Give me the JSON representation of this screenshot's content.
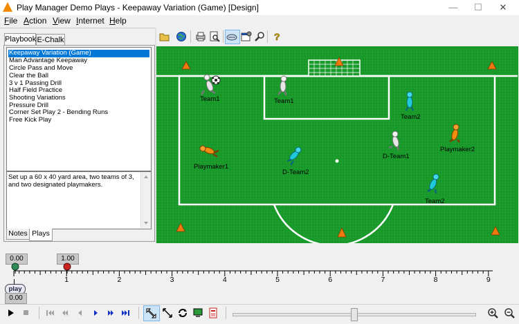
{
  "window": {
    "title": "Play Manager Demo Plays - Keepaway Variation (Game) [Design]",
    "controls": {
      "minimize": "—",
      "maximize": "☐",
      "close": "✕"
    }
  },
  "menu": {
    "items": [
      {
        "label": "File",
        "accel": "F",
        "rest": "ile"
      },
      {
        "label": "Action",
        "accel": "A",
        "rest": "ction"
      },
      {
        "label": "View",
        "accel": "V",
        "rest": "iew"
      },
      {
        "label": "Internet",
        "accel": "I",
        "rest": "nternet"
      },
      {
        "label": "Help",
        "accel": "H",
        "rest": "elp"
      }
    ]
  },
  "left_panel": {
    "tabs": [
      "Playbook",
      "E-Chalk"
    ],
    "plays": [
      "Keepaway Variation (Game)",
      "Man Advantage Keepaway",
      "Circle Pass and Move",
      "Clear the Ball",
      "3 v 1 Passing Drill",
      "Half Field Practice",
      "Shooting Variations",
      "Pressure Drill",
      "Corner Set Play 2 - Bending Runs",
      "Free Kick Play"
    ],
    "selected_play": "Keepaway Variation (Game)",
    "notes_text": "Set up a 60 x 40 yard area, two teams of 3, and two designated playmakers.",
    "bottom_tabs": [
      "Notes",
      "Plays"
    ]
  },
  "toolbar": {
    "icons": [
      "open-folder-icon",
      "globe-icon",
      "print-icon",
      "print-preview-icon",
      "field-view-icon",
      "properties-icon",
      "zoom-tool-icon",
      "help-icon"
    ]
  },
  "field": {
    "colors": {
      "grass": "#1b9a2c",
      "lines": "#ffffff",
      "cone": "#f07a10",
      "team1": "#e6e6e6",
      "team2": "#20c8dc",
      "playmaker": "#f08c10"
    },
    "players": [
      {
        "label": "Team1",
        "team": "team1"
      },
      {
        "label": "Team1",
        "team": "team1"
      },
      {
        "label": "Team2",
        "team": "team2"
      },
      {
        "label": "Playmaker2",
        "team": "playmaker"
      },
      {
        "label": "D-Team1",
        "team": "team1"
      },
      {
        "label": "Playmaker1",
        "team": "playmaker"
      },
      {
        "label": "D-Team2",
        "team": "team2"
      },
      {
        "label": "Team2",
        "team": "team2"
      }
    ]
  },
  "timeline": {
    "ticks": [
      "1",
      "2",
      "3",
      "4",
      "5",
      "6",
      "7",
      "8",
      "9"
    ],
    "keyframes": [
      {
        "time": "0.00",
        "color": "#2e8b57"
      },
      {
        "time": "1.00",
        "color": "#cc2222"
      }
    ],
    "play_label": "play",
    "current_time": "0.00"
  },
  "playback": {
    "buttons": [
      "play-icon",
      "stop-icon",
      "first-frame-icon",
      "prev-frame-icon",
      "step-back-icon",
      "step-forward-icon",
      "next-frame-icon",
      "last-frame-icon",
      "select-region-icon",
      "resize-icon",
      "loop-icon",
      "monitor-icon",
      "clip-icon"
    ],
    "slider_value": 0.5,
    "zoom": [
      "zoom-in-icon",
      "zoom-out-icon"
    ]
  }
}
